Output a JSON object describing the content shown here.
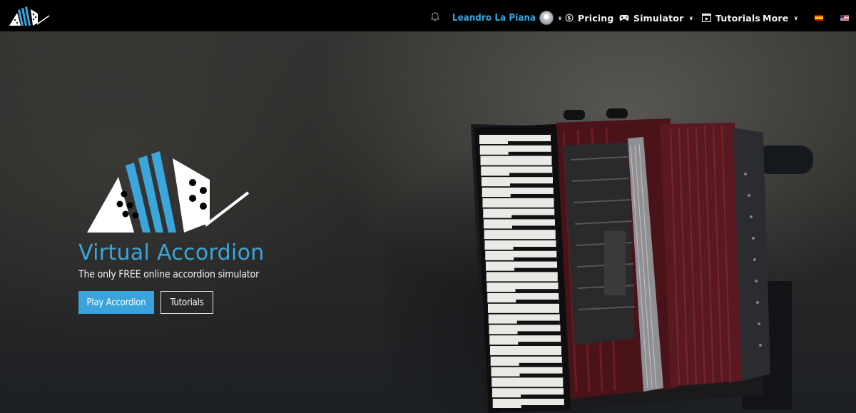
{
  "navbar": {
    "brand_icon": "virtual-accordion-logo",
    "bell_icon": "bell-icon",
    "user": {
      "name": "Leandro La Piana",
      "avatar_icon": "user-avatar"
    },
    "pricing": {
      "label": "Pricing",
      "icon": "dollar-circle-icon"
    },
    "simulator": {
      "label": "Simulator",
      "icon": "gamepad-icon"
    },
    "tutorials": {
      "label": "Tutorials",
      "icon": "play-square-icon"
    },
    "more": {
      "label": "More"
    },
    "languages": [
      {
        "code": "es",
        "icon": "spain-flag-icon"
      },
      {
        "code": "en",
        "icon": "usa-flag-icon"
      }
    ]
  },
  "hero": {
    "title": "Virtual Accordion",
    "subtitle": "The only FREE online accordion simulator",
    "play_button": "Play Accordion",
    "tutorials_button": "Tutorials",
    "background_image": "accordion-on-dark-wall-photo"
  },
  "colors": {
    "accent": "#3aa6dc",
    "navbar_bg": "#000000",
    "text_light": "#f2f2f2"
  }
}
